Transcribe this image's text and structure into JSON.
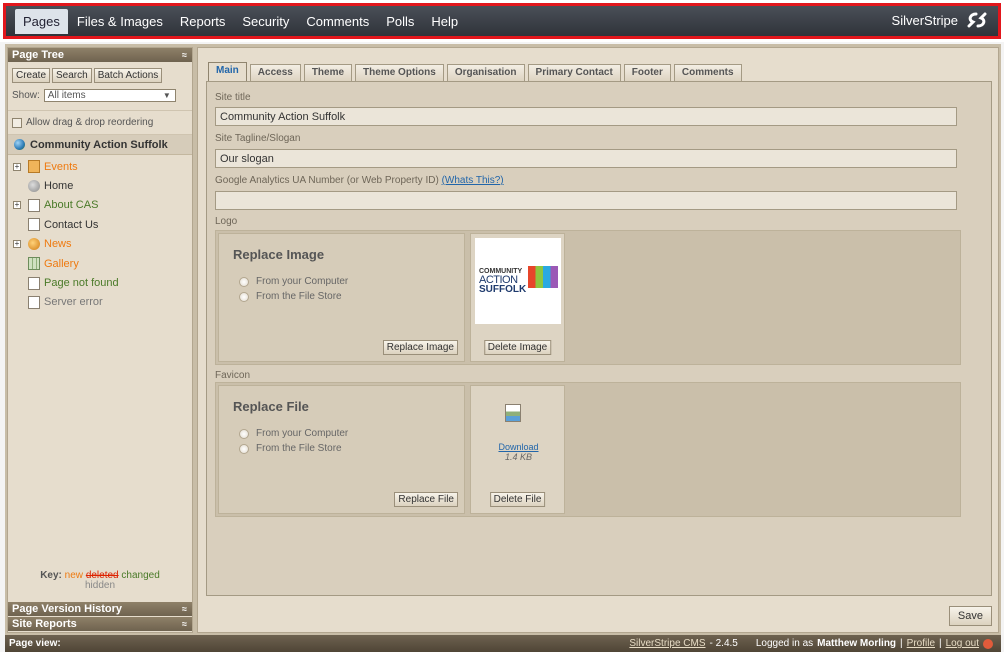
{
  "topnav": {
    "items": [
      "Pages",
      "Files & Images",
      "Reports",
      "Security",
      "Comments",
      "Polls",
      "Help"
    ],
    "active": "Pages",
    "brand": "SilverStripe"
  },
  "left": {
    "page_tree_title": "Page Tree",
    "buttons": [
      "Create",
      "Search",
      "Batch Actions"
    ],
    "show_label": "Show:",
    "show_value": "All items",
    "drag_label": "Allow drag & drop reordering",
    "root": "Community Action Suffolk",
    "tree": [
      {
        "label": "Events",
        "state": "new",
        "icon": "calendar",
        "expandable": true
      },
      {
        "label": "Home",
        "state": "normal",
        "icon": "home",
        "expandable": false
      },
      {
        "label": "About CAS",
        "state": "changed",
        "icon": "page",
        "expandable": true
      },
      {
        "label": "Contact Us",
        "state": "normal",
        "icon": "page",
        "expandable": false
      },
      {
        "label": "News",
        "state": "new",
        "icon": "news",
        "expandable": true
      },
      {
        "label": "Gallery",
        "state": "new",
        "icon": "gallery",
        "expandable": false
      },
      {
        "label": "Page not found",
        "state": "changed",
        "icon": "page",
        "expandable": false
      },
      {
        "label": "Server error",
        "state": "hidden",
        "icon": "page",
        "expandable": false
      }
    ],
    "key": {
      "label": "Key:",
      "new": "new",
      "deleted": "deleted",
      "changed": "changed",
      "hidden": "hidden"
    },
    "version_history": "Page Version History",
    "site_reports": "Site Reports"
  },
  "tabs": [
    "Main",
    "Access",
    "Theme",
    "Theme Options",
    "Organisation",
    "Primary Contact",
    "Footer",
    "Comments"
  ],
  "active_tab": "Main",
  "form": {
    "site_title_label": "Site title",
    "site_title_value": "Community Action Suffolk",
    "tagline_label": "Site Tagline/Slogan",
    "tagline_value": "Our slogan",
    "ga_label": "Google Analytics UA Number (or Web Property ID)",
    "ga_link": "(Whats This?)",
    "ga_value": "",
    "logo_label": "Logo",
    "logo": {
      "heading": "Replace Image",
      "option1": "From your Computer",
      "option2": "From the File Store",
      "replace_button": "Replace Image",
      "delete_button": "Delete Image",
      "image_text1": "COMMUNITY",
      "image_text2": "ACTION",
      "image_text3": "SUFFOLK"
    },
    "favicon_label": "Favicon",
    "favicon": {
      "heading": "Replace File",
      "option1": "From your Computer",
      "option2": "From the File Store",
      "replace_button": "Replace File",
      "delete_button": "Delete File",
      "download_link": "Download",
      "file_size": "1.4 KB"
    },
    "save_button": "Save"
  },
  "status": {
    "page_view": "Page view:",
    "cms_link": "SilverStripe CMS",
    "version": "- 2.4.5",
    "logged_prefix": "Logged in as",
    "user": "Matthew Morling",
    "profile": "Profile",
    "logout": "Log out"
  }
}
